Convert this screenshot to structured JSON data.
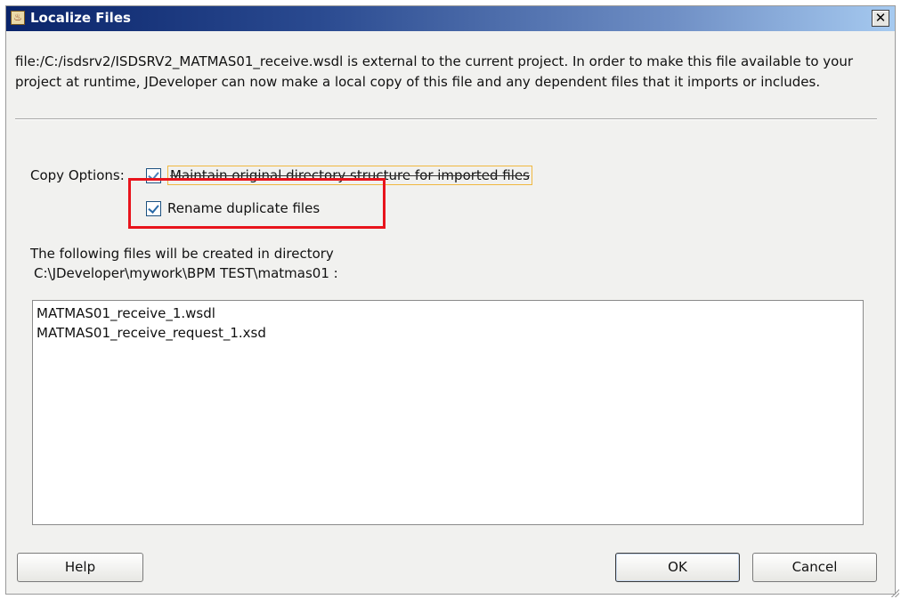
{
  "window": {
    "title": "Localize Files",
    "close_glyph": "✕",
    "title_icon": "java-cup-icon"
  },
  "message": "file:/C:/isdsrv2/ISDSRV2_MATMAS01_receive.wsdl is external to the current project. In order to make this file available to your project at runtime, JDeveloper can now make a local copy of this file and any dependent files that it imports or includes.",
  "copy_options": {
    "label": "Copy Options:",
    "options": [
      {
        "label": "Maintain original directory structure for imported files",
        "checked": true
      },
      {
        "label": "Rename duplicate files",
        "checked": true
      }
    ]
  },
  "directory": {
    "line1": "The following files will be created in directory",
    "line2": "C:\\JDeveloper\\mywork\\BPM TEST\\matmas01 :"
  },
  "files": [
    "MATMAS01_receive_1.wsdl",
    "MATMAS01_receive_request_1.xsd"
  ],
  "buttons": {
    "help": "Help",
    "ok": "OK",
    "cancel": "Cancel"
  },
  "colors": {
    "title_bar_start": "#0a246a",
    "title_bar_end": "#a6caf0",
    "highlight_box": "#e8141c",
    "focus_ring": "#f0b840"
  }
}
